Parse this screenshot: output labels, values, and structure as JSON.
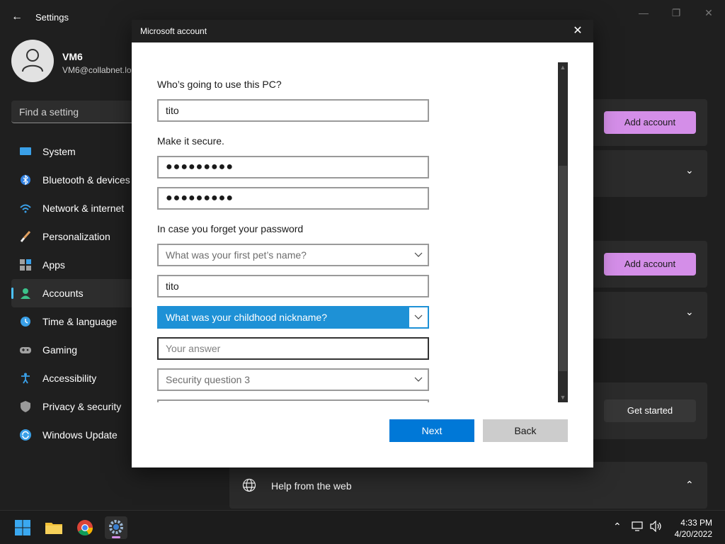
{
  "window": {
    "title": "Settings",
    "back_glyph": "←",
    "minimize_glyph": "—",
    "maximize_glyph": "❐",
    "close_glyph": "✕"
  },
  "profile": {
    "name": "VM6",
    "email": "VM6@collabnet.lo"
  },
  "search": {
    "placeholder": "Find a setting"
  },
  "nav": {
    "items": [
      {
        "label": "System",
        "icon": "monitor-icon"
      },
      {
        "label": "Bluetooth & devices",
        "icon": "bluetooth-icon"
      },
      {
        "label": "Network & internet",
        "icon": "wifi-icon"
      },
      {
        "label": "Personalization",
        "icon": "brush-icon"
      },
      {
        "label": "Apps",
        "icon": "apps-icon"
      },
      {
        "label": "Accounts",
        "icon": "person-icon",
        "active": true
      },
      {
        "label": "Time & language",
        "icon": "clock-globe-icon"
      },
      {
        "label": "Gaming",
        "icon": "gamepad-icon"
      },
      {
        "label": "Accessibility",
        "icon": "accessibility-icon"
      },
      {
        "label": "Privacy & security",
        "icon": "shield-icon"
      },
      {
        "label": "Windows Update",
        "icon": "update-icon"
      }
    ]
  },
  "background_panels": {
    "add_account_1": "Add account",
    "add_account_2": "Add account",
    "get_started": "Get started",
    "chevron_glyph": "⌄",
    "help_label": "Help from the web",
    "help_chevron": "⌃"
  },
  "dialog": {
    "title": "Microsoft account",
    "close_glyph": "✕",
    "who_label": "Who’s going to use this PC?",
    "username_value": "tito",
    "secure_label": "Make it secure.",
    "password_value": "●●●●●●●●●",
    "confirm_password_value": "●●●●●●●●●",
    "forget_label": "In case you forget your password",
    "question1_placeholder": "What was your first pet’s name?",
    "answer1_value": "tito",
    "question2_value": "What was your childhood nickname?",
    "answer2_placeholder": "Your answer",
    "question3_placeholder": "Security question 3",
    "next_label": "Next",
    "back_label": "Back",
    "scroll_up_glyph": "▲",
    "scroll_down_glyph": "▼"
  },
  "taskbar": {
    "apps": [
      "start-icon",
      "file-explorer-icon",
      "chrome-icon",
      "settings-icon"
    ],
    "tray_chevron": "⌃",
    "time": "4:33 PM",
    "date": "4/20/2022"
  },
  "colors": {
    "accent": "#0078d7",
    "selection": "#1e91d6",
    "purple_button": "#d48ee8",
    "nav_accent": "#4cc2ff"
  }
}
